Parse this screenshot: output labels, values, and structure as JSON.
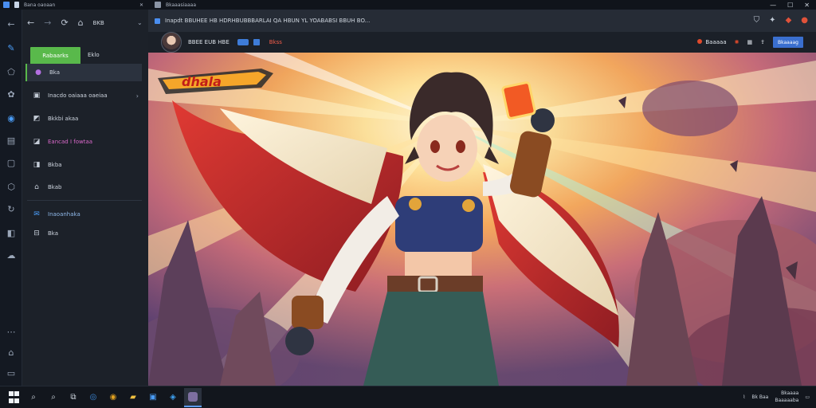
{
  "window": {
    "left_title": "Bana oaoaan",
    "right_title": "Bkaaasiaaaa",
    "controls": [
      "—",
      "☐",
      "✕"
    ]
  },
  "rail": {
    "icons": [
      "back-arrow-icon",
      "pen-icon",
      "tag-icon",
      "flower-icon",
      "compass-icon",
      "book-icon",
      "square-icon",
      "cube-icon",
      "refresh-icon",
      "edit-icon",
      "cloud-icon",
      "more-icon",
      "home-icon",
      "window-icon"
    ]
  },
  "sidebar": {
    "nav_back": "←",
    "nav_fwd": "→",
    "nav_reload": "⟳",
    "nav_home": "⌂",
    "nav_text": "BKB",
    "nav_chevron": "⌄",
    "primary_button": "Rabaarks",
    "option_label": "Eklo",
    "items": [
      {
        "label": "Bka",
        "icon": "●",
        "color": "#b36fe2",
        "selected": true
      },
      {
        "label": "Inacdo oaiaaa oaeiaa",
        "icon": "▣",
        "arrow": "›"
      },
      {
        "label": "Bkkbi akaa",
        "icon": "◩"
      },
      {
        "label": "Eancad I fowtaa",
        "icon": "◪",
        "color": "#d868c9"
      },
      {
        "label": "Bkba",
        "icon": "◨"
      },
      {
        "label": "Bkab",
        "icon": "⌂"
      },
      {
        "label": "Inaoanhaka",
        "icon": "✉",
        "color": "#4a9df8"
      },
      {
        "label": "Bka",
        "icon": "⊟"
      }
    ]
  },
  "content": {
    "address": "Inapdt BBUHEE HB HDRHBUBBBARLAI QA HBUN YL YOABABSI BBUH BO...",
    "toolbar_title": "BBEE EUB HBE",
    "toolbar_tag": "Bkss",
    "toolbar_right_label": "Baaaaa",
    "toolbar_button": "Bkaaaag",
    "artwork_logo": "dhala"
  },
  "taskbar": {
    "tray_text": "Bk Baa",
    "time": "Bkaaaa",
    "date": "Baaaaaba"
  }
}
